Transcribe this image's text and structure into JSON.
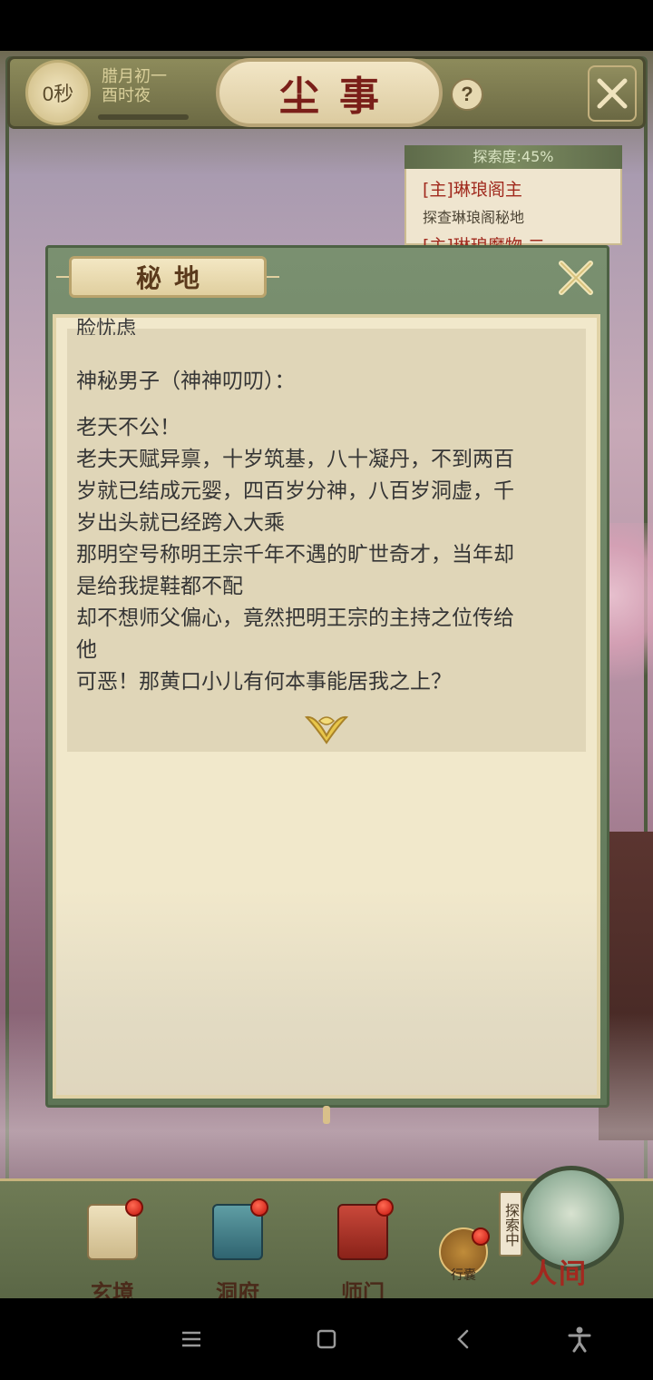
{
  "header": {
    "timer": "0秒",
    "date_line1": "腊月初一",
    "date_line2": "酉时夜",
    "title": "尘事",
    "help_label": "?"
  },
  "exploration": {
    "progress_label": "探索度:45%",
    "progress": 45,
    "quest_title": "[主]琳琅阁主",
    "quest_desc": "探查琳琅阁秘地",
    "quest_next": "[主]琳琅魔物 二"
  },
  "modal": {
    "title": "秘地",
    "cut_text": "脸忧虑",
    "speaker": "神秘男子（神神叨叨）：",
    "lines": [
      "老天不公！",
      "老夫天赋异禀，十岁筑基，八十凝丹，不到两百",
      "岁就已结成元婴，四百岁分神，八百岁洞虚，千",
      "岁出头就已经跨入大乘",
      "那明空号称明王宗千年不遇的旷世奇才，当年却",
      "是给我提鞋都不配",
      "却不想师父偏心，竟然把明王宗的主持之位传给",
      "他",
      "可恶！那黄口小儿有何本事能居我之上？"
    ]
  },
  "bottom_nav": {
    "items": [
      {
        "label": "玄境"
      },
      {
        "label": "洞府"
      },
      {
        "label": "师门"
      }
    ],
    "bag_label": "行囊",
    "explore_tag": "探索中",
    "world_label": "人间"
  },
  "colors": {
    "frame_green": "#5e7556",
    "parchment": "#f1e8cb",
    "title_red": "#7a1f19",
    "quest_red": "#a12a1e"
  },
  "icons": {
    "close": "close-icon",
    "help": "help-icon",
    "continue": "continue-arrow-icon",
    "menu": "menu-icon",
    "home": "home-icon",
    "back": "back-icon",
    "accessibility": "accessibility-icon"
  }
}
